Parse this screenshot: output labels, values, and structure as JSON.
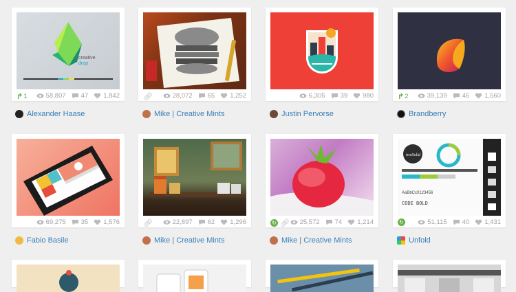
{
  "shots": [
    {
      "rebounds": "1",
      "views": "58,807",
      "comments": "47",
      "likes": "1,842",
      "author": "Alexander Haase",
      "title_a": "creative",
      "title_b": "drop"
    },
    {
      "views": "28,072",
      "comments": "65",
      "likes": "1,252",
      "author": "Mike | Creative Mints"
    },
    {
      "views": "6,305",
      "comments": "39",
      "likes": "980",
      "author": "Justin Pervorse"
    },
    {
      "rebounds": "2",
      "views": "39,139",
      "comments": "46",
      "likes": "1,560",
      "author": "Brandberry"
    },
    {
      "views": "69,275",
      "comments": "35",
      "likes": "1,576",
      "author": "Fabio Basile"
    },
    {
      "views": "22,897",
      "comments": "62",
      "likes": "1,296",
      "author": "Mike | Creative Mints"
    },
    {
      "views": "25,572",
      "comments": "74",
      "likes": "1,214",
      "author": "Mike | Creative Mints"
    },
    {
      "views": "51,115",
      "comments": "40",
      "likes": "1,431",
      "author": "Unfold",
      "brand_word": "twoSolid",
      "mono_label": "CODE BOLD",
      "hex_label": "AaBbCc0123456"
    }
  ],
  "colors": {
    "link": "#3a7fb7",
    "muted": "#a3a3a3",
    "rebound": "#6ab04c",
    "bg": "#efefef"
  }
}
